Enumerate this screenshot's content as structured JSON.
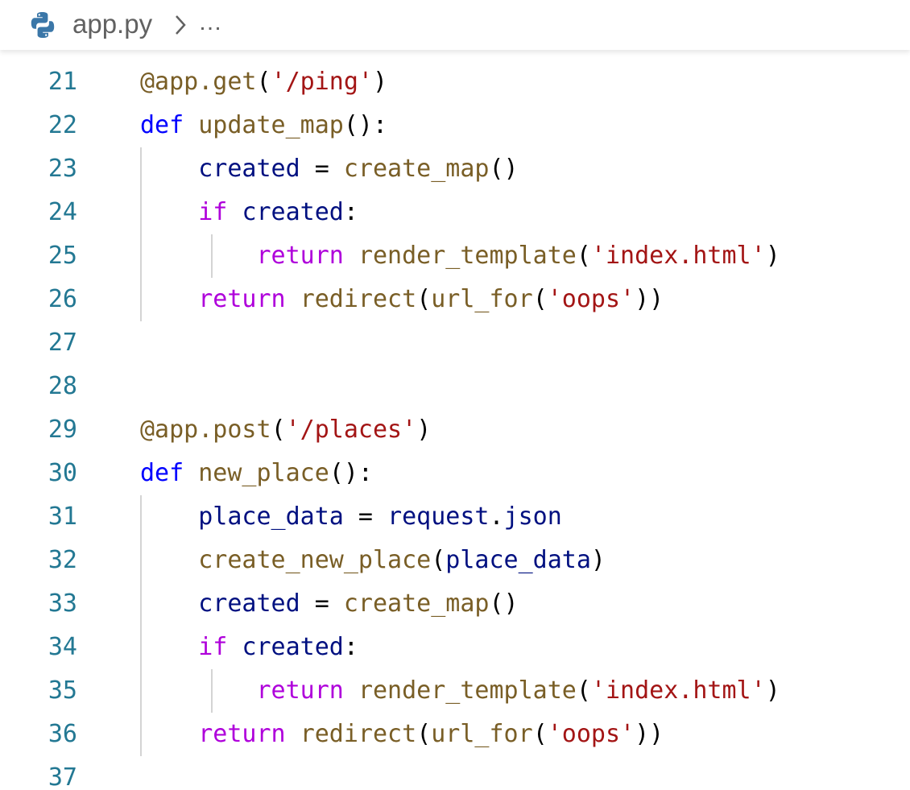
{
  "breadcrumb": {
    "file": "app.py",
    "ellipsis": "…",
    "icon": "python-icon",
    "separator_icon": "chevron-right-icon"
  },
  "colors": {
    "line_number": "#237893",
    "keyword": "#0000ff",
    "control": "#af00db",
    "function": "#795e26",
    "variable": "#001080",
    "string": "#a31515"
  },
  "editor": {
    "lines": [
      {
        "number": "21",
        "tokens": [
          {
            "t": "@app.get",
            "c": "fn"
          },
          {
            "t": "(",
            "c": "pun"
          },
          {
            "t": "'/ping'",
            "c": "str"
          },
          {
            "t": ")",
            "c": "pun"
          }
        ]
      },
      {
        "number": "22",
        "tokens": [
          {
            "t": "def",
            "c": "kw"
          },
          {
            "t": " ",
            "c": "pun"
          },
          {
            "t": "update_map",
            "c": "fn"
          },
          {
            "t": "():",
            "c": "pun"
          }
        ]
      },
      {
        "number": "23",
        "tokens": [
          {
            "t": "    ",
            "c": "pun"
          },
          {
            "t": "created",
            "c": "var"
          },
          {
            "t": " = ",
            "c": "pun"
          },
          {
            "t": "create_map",
            "c": "fn"
          },
          {
            "t": "()",
            "c": "pun"
          }
        ]
      },
      {
        "number": "24",
        "tokens": [
          {
            "t": "    ",
            "c": "pun"
          },
          {
            "t": "if",
            "c": "ctl"
          },
          {
            "t": " ",
            "c": "pun"
          },
          {
            "t": "created",
            "c": "var"
          },
          {
            "t": ":",
            "c": "pun"
          }
        ]
      },
      {
        "number": "25",
        "tokens": [
          {
            "t": "        ",
            "c": "pun"
          },
          {
            "t": "return",
            "c": "ctl"
          },
          {
            "t": " ",
            "c": "pun"
          },
          {
            "t": "render_template",
            "c": "fn"
          },
          {
            "t": "(",
            "c": "pun"
          },
          {
            "t": "'index.html'",
            "c": "str"
          },
          {
            "t": ")",
            "c": "pun"
          }
        ]
      },
      {
        "number": "26",
        "tokens": [
          {
            "t": "    ",
            "c": "pun"
          },
          {
            "t": "return",
            "c": "ctl"
          },
          {
            "t": " ",
            "c": "pun"
          },
          {
            "t": "redirect",
            "c": "fn"
          },
          {
            "t": "(",
            "c": "pun"
          },
          {
            "t": "url_for",
            "c": "fn"
          },
          {
            "t": "(",
            "c": "pun"
          },
          {
            "t": "'oops'",
            "c": "str"
          },
          {
            "t": "))",
            "c": "pun"
          }
        ]
      },
      {
        "number": "27",
        "tokens": []
      },
      {
        "number": "28",
        "tokens": []
      },
      {
        "number": "29",
        "tokens": [
          {
            "t": "@app.post",
            "c": "fn"
          },
          {
            "t": "(",
            "c": "pun"
          },
          {
            "t": "'/places'",
            "c": "str"
          },
          {
            "t": ")",
            "c": "pun"
          }
        ]
      },
      {
        "number": "30",
        "tokens": [
          {
            "t": "def",
            "c": "kw"
          },
          {
            "t": " ",
            "c": "pun"
          },
          {
            "t": "new_place",
            "c": "fn"
          },
          {
            "t": "():",
            "c": "pun"
          }
        ]
      },
      {
        "number": "31",
        "tokens": [
          {
            "t": "    ",
            "c": "pun"
          },
          {
            "t": "place_data",
            "c": "var"
          },
          {
            "t": " = ",
            "c": "pun"
          },
          {
            "t": "request",
            "c": "var"
          },
          {
            "t": ".",
            "c": "pun"
          },
          {
            "t": "json",
            "c": "var"
          }
        ]
      },
      {
        "number": "32",
        "tokens": [
          {
            "t": "    ",
            "c": "pun"
          },
          {
            "t": "create_new_place",
            "c": "fn"
          },
          {
            "t": "(",
            "c": "pun"
          },
          {
            "t": "place_data",
            "c": "var"
          },
          {
            "t": ")",
            "c": "pun"
          }
        ]
      },
      {
        "number": "33",
        "tokens": [
          {
            "t": "    ",
            "c": "pun"
          },
          {
            "t": "created",
            "c": "var"
          },
          {
            "t": " = ",
            "c": "pun"
          },
          {
            "t": "create_map",
            "c": "fn"
          },
          {
            "t": "()",
            "c": "pun"
          }
        ]
      },
      {
        "number": "34",
        "tokens": [
          {
            "t": "    ",
            "c": "pun"
          },
          {
            "t": "if",
            "c": "ctl"
          },
          {
            "t": " ",
            "c": "pun"
          },
          {
            "t": "created",
            "c": "var"
          },
          {
            "t": ":",
            "c": "pun"
          }
        ]
      },
      {
        "number": "35",
        "tokens": [
          {
            "t": "        ",
            "c": "pun"
          },
          {
            "t": "return",
            "c": "ctl"
          },
          {
            "t": " ",
            "c": "pun"
          },
          {
            "t": "render_template",
            "c": "fn"
          },
          {
            "t": "(",
            "c": "pun"
          },
          {
            "t": "'index.html'",
            "c": "str"
          },
          {
            "t": ")",
            "c": "pun"
          }
        ]
      },
      {
        "number": "36",
        "tokens": [
          {
            "t": "    ",
            "c": "pun"
          },
          {
            "t": "return",
            "c": "ctl"
          },
          {
            "t": " ",
            "c": "pun"
          },
          {
            "t": "redirect",
            "c": "fn"
          },
          {
            "t": "(",
            "c": "pun"
          },
          {
            "t": "url_for",
            "c": "fn"
          },
          {
            "t": "(",
            "c": "pun"
          },
          {
            "t": "'oops'",
            "c": "str"
          },
          {
            "t": "))",
            "c": "pun"
          }
        ]
      },
      {
        "number": "37",
        "tokens": []
      }
    ]
  }
}
